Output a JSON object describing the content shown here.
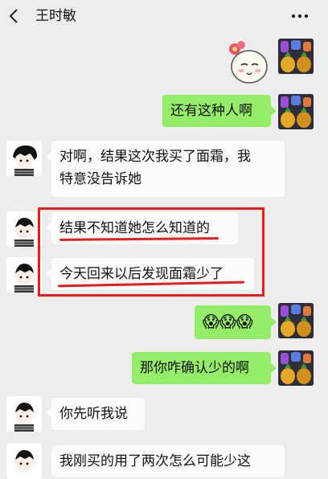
{
  "header": {
    "title": "王时敏"
  },
  "messages": [
    {
      "from": "me",
      "type": "sticker",
      "icon": "smiling-face-with-flower-sticker"
    },
    {
      "from": "me",
      "type": "text",
      "text": "还有这种人啊"
    },
    {
      "from": "other",
      "type": "text",
      "line1": "对啊，结果这次我买了面霜，我",
      "line2": "特意没告诉她"
    },
    {
      "from": "other",
      "type": "text",
      "text": "结果不知道她怎么知道的"
    },
    {
      "from": "other",
      "type": "text",
      "text": "今天回来以后发现面霜少了"
    },
    {
      "from": "me",
      "type": "text",
      "text": "😱😱😱"
    },
    {
      "from": "me",
      "type": "text",
      "text": "那你咋确认少的啊"
    },
    {
      "from": "other",
      "type": "text",
      "text": "你先听我说"
    },
    {
      "from": "other",
      "type": "text",
      "text": "我刚买的用了两次怎么可能少这"
    }
  ],
  "colors": {
    "outgoing_bubble": "#95ec69",
    "incoming_bubble": "#fbfbfb",
    "annotation": "#e81c1c",
    "background": "#ededed"
  }
}
